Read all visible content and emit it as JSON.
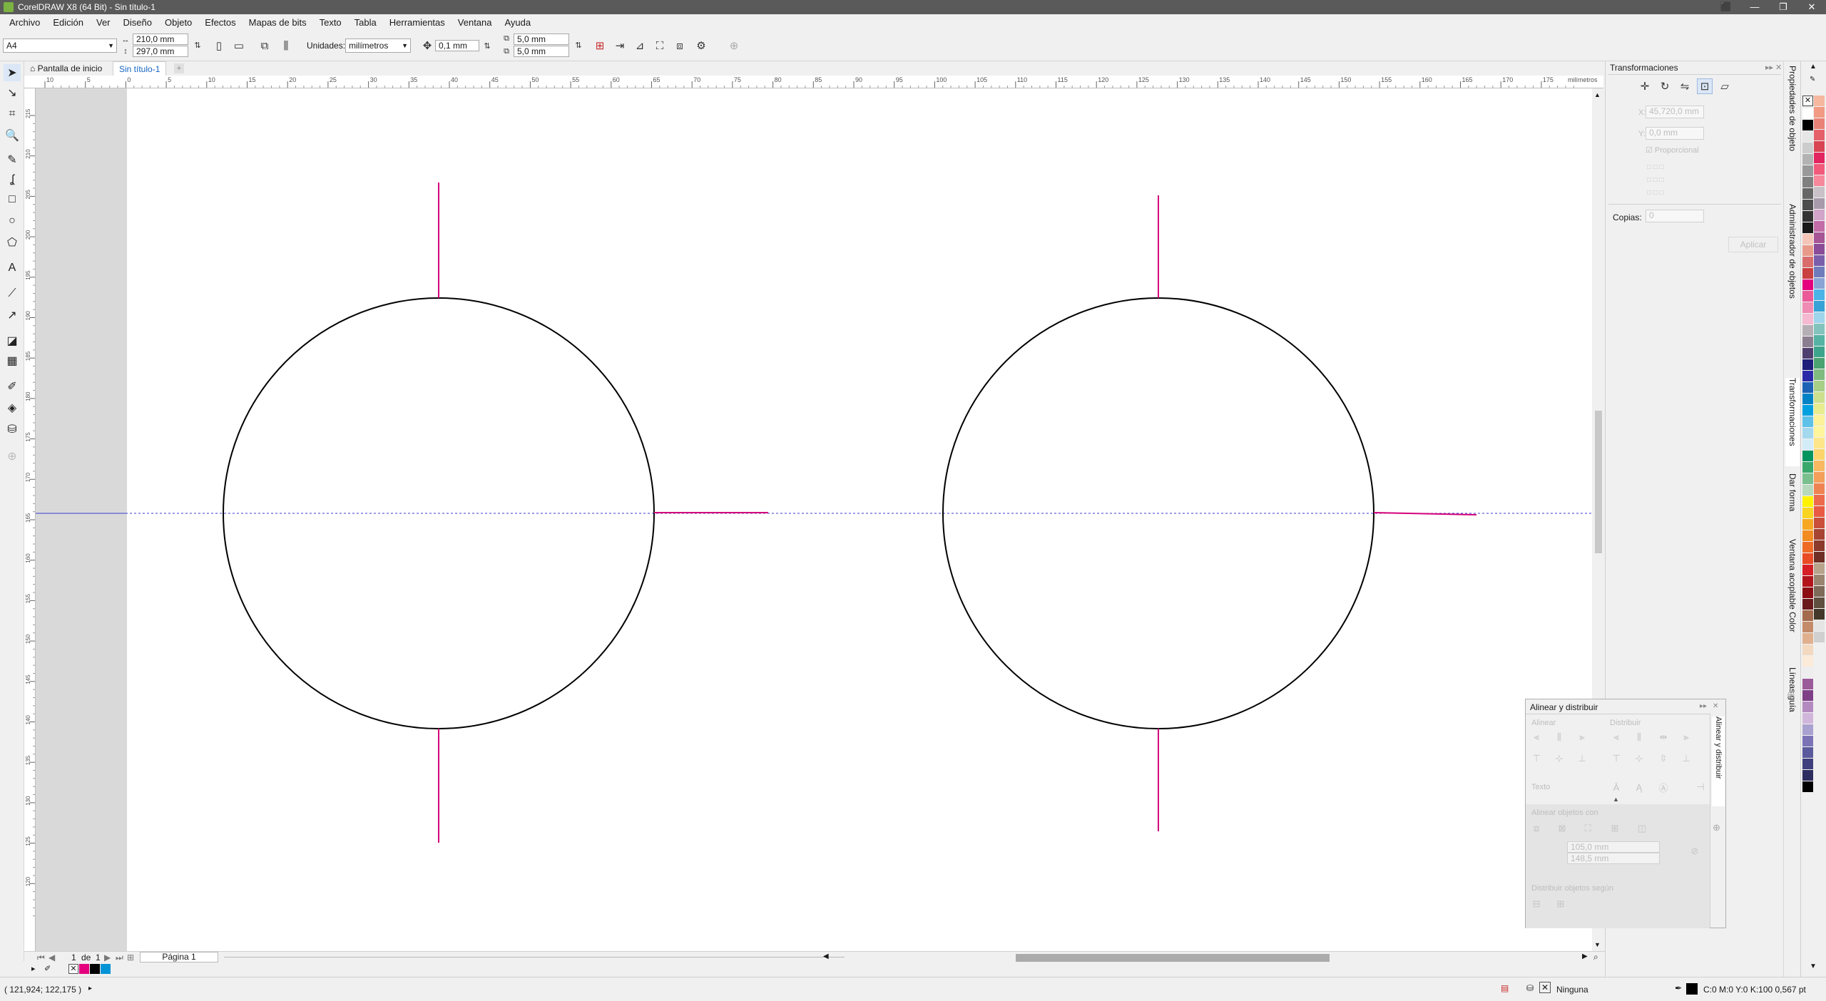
{
  "app": {
    "title": "CorelDRAW X8 (64 Bit) - Sin título-1"
  },
  "menu": [
    "Archivo",
    "Edición",
    "Ver",
    "Diseño",
    "Objeto",
    "Efectos",
    "Mapas de bits",
    "Texto",
    "Tabla",
    "Herramientas",
    "Ventana",
    "Ayuda"
  ],
  "propbar": {
    "page_size": "A4",
    "width": "210,0 mm",
    "height": "297,0 mm",
    "units_label": "Unidades:",
    "units_value": "milímetros",
    "nudge": "0,1 mm",
    "dup_x": "5,0 mm",
    "dup_y": "5,0 mm"
  },
  "tabs": {
    "home": "Pantalla de inicio",
    "doc": "Sin título-1"
  },
  "ruler": {
    "h_labels": [
      "10",
      "5",
      "0",
      "5",
      "10",
      "15",
      "20",
      "25",
      "30",
      "35",
      "40",
      "45",
      "50",
      "55",
      "60",
      "65",
      "70",
      "75",
      "80",
      "85",
      "90",
      "95",
      "100",
      "105",
      "110",
      "115",
      "120",
      "125",
      "130",
      "135",
      "140",
      "145",
      "150",
      "155",
      "160",
      "165",
      "170",
      "175"
    ],
    "h_unit": "milímetros",
    "v_labels": [
      "215",
      "210",
      "205",
      "200",
      "195",
      "190",
      "185",
      "180",
      "175",
      "170",
      "165",
      "160",
      "155",
      "150",
      "145",
      "140",
      "135",
      "130",
      "125",
      "120"
    ]
  },
  "transform_panel": {
    "title": "Transformaciones",
    "x_label": "X:",
    "x_value": "45,720,0 mm",
    "y_label": "Y:",
    "y_value": "0,0 mm",
    "proportional": "Proporcional",
    "copies_label": "Copias:",
    "copies_value": "0",
    "apply": "Aplicar"
  },
  "dock_tabs": [
    "Propiedades de objeto",
    "Administrador de objetos",
    "Transformaciones",
    "Dar forma",
    "Ventana acoplable Color",
    "Líneas guía"
  ],
  "align_panel": {
    "title": "Alinear y distribuir",
    "align": "Alinear",
    "distribute": "Distribuir",
    "text": "Texto",
    "align_objects_to": "Alinear objetos con",
    "x_value": "105,0 mm",
    "y_value": "148,5 mm",
    "distribute_objects_by": "Distribuir objetos según",
    "side_tab": "Alinear y distribuir"
  },
  "pager": {
    "current": "1",
    "of_label": "de",
    "total": "1",
    "page_tab": "Página 1"
  },
  "status": {
    "coords": "( 121,924; 122,175 )",
    "fill_label": "Ninguna",
    "outline_info": "C:0 M:0 Y:0 K:100  0,567 pt"
  },
  "palette_colors": [
    "#ffffff",
    "#000000",
    "#e6e6e6",
    "#cccccc",
    "#b3b3b3",
    "#999999",
    "#808080",
    "#666666",
    "#4d4d4d",
    "#333333",
    "#1a1a1a",
    "#f5c6b8",
    "#e89a8a",
    "#d96d6d",
    "#c94040",
    "#e5007e",
    "#ea5a98",
    "#f08bb3",
    "#f5b9d1",
    "#b5aeb5",
    "#8c7e91",
    "#4f3f6e",
    "#1f1f7a",
    "#2a2aa8",
    "#1c63b6",
    "#0083c4",
    "#00a0e0",
    "#5dc1ea",
    "#a4d8ef",
    "#d3ecf7",
    "#00945e",
    "#3ba86b",
    "#7ac08e",
    "#b6d9bc",
    "#fff200",
    "#f9d423",
    "#f7a823",
    "#f28b21",
    "#ee6b25",
    "#e94b25",
    "#d61f26",
    "#b3131b",
    "#8c0d14",
    "#6a1a1a",
    "#a46b4e",
    "#c48b6a",
    "#e0b08e",
    "#f3d9c0",
    "#fcebd9",
    "#eeeeee",
    "#9b5a9a",
    "#7e3f86",
    "#b38ac0",
    "#d1b6dc",
    "#a9a1cf",
    "#7b73b6",
    "#5b5a9c",
    "#3f3f7d",
    "#2d2d5f",
    "#000000"
  ],
  "palette_right_colors": [
    "#f6b9a0",
    "#f29b84",
    "#e98277",
    "#e5616a",
    "#d94453",
    "#e2245f",
    "#f25a7c",
    "#f7889b",
    "#c9c1c8",
    "#a79aab",
    "#d1a4c9",
    "#c36ca8",
    "#a65596",
    "#8a4c98",
    "#7b5eab",
    "#6f7cbc",
    "#8aa4d5",
    "#4bb4e6",
    "#36a2d5",
    "#9ed4ec",
    "#82c4bd",
    "#55b3a4",
    "#3ea58d",
    "#4aa371",
    "#80bb7f",
    "#a8cf86",
    "#cde08d",
    "#e7ec8f",
    "#fbf29a",
    "#fff59d",
    "#fde68a",
    "#fbd56b",
    "#f8b961",
    "#f49f5a",
    "#f08352",
    "#ec6b4c",
    "#e85a43",
    "#c94f3a",
    "#a84433",
    "#8b3a2c",
    "#6e3025",
    "#b8a38c",
    "#9a8571",
    "#7d6a58",
    "#5f5040",
    "#433829",
    "#e5e5e5",
    "#d0d0d0"
  ]
}
